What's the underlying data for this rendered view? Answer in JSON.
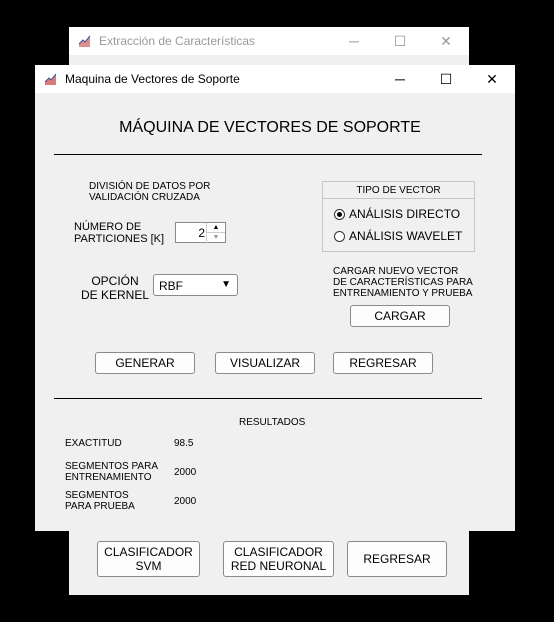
{
  "back_window": {
    "title": "Extracción de Características",
    "buttons": {
      "svm": "CLASIFICADOR\nSVM",
      "neural": "CLASIFICADOR\nRED NEURONAL",
      "back": "REGRESAR"
    }
  },
  "window": {
    "title": "Maquina de Vectores de Soporte",
    "heading": "MÁQUINA DE VECTORES DE SOPORTE",
    "division_label": "DIVISIÓN DE DATOS POR\nVALIDACIÓN CRUZADA",
    "partitions_label": "NÚMERO DE\nPARTICIONES [K]",
    "partitions_value": "2",
    "kernel_label": "OPCIÓN\nDE KERNEL",
    "kernel_value": "RBF",
    "vector_type": {
      "title": "TIPO DE VECTOR",
      "options": [
        {
          "label": "ANÁLISIS DIRECTO",
          "selected": true
        },
        {
          "label": "ANÁLISIS WAVELET",
          "selected": false
        }
      ]
    },
    "load_label": "CARGAR NUEVO VECTOR\nDE CARACTERÍSTICAS PARA\nENTRENAMIENTO Y PRUEBA",
    "load_button": "CARGAR",
    "generate_button": "GENERAR",
    "visualize_button": "VISUALIZAR",
    "back_button": "REGRESAR",
    "results": {
      "title": "RESULTADOS",
      "rows": [
        {
          "label": "EXACTITUD",
          "value": "98.5"
        },
        {
          "label": "SEGMENTOS PARA\nENTRENAMIENTO",
          "value": "2000"
        },
        {
          "label": "SEGMENTOS\nPARA PRUEBA",
          "value": "2000"
        }
      ]
    }
  }
}
